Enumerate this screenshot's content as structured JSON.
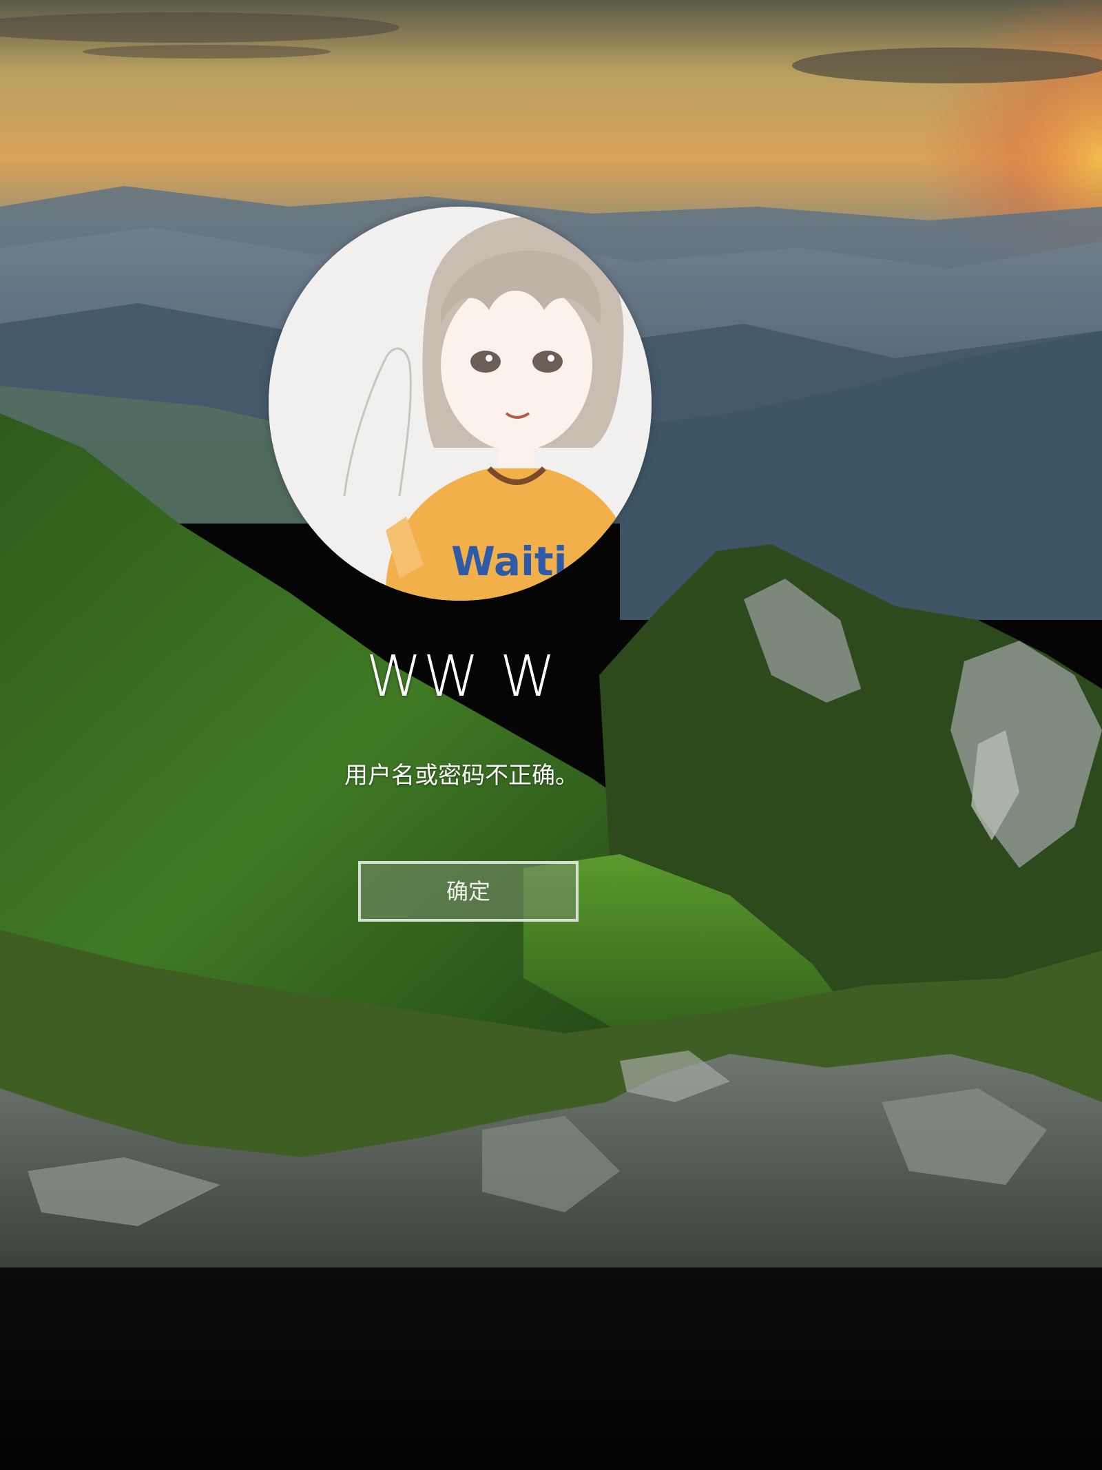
{
  "login": {
    "user_name": "WW W",
    "error_message": "用户名或密码不正确。",
    "ok_button_label": "确定",
    "avatar": "user-avatar-anime-girl",
    "avatar_shirt_text": "Waiti"
  },
  "background": {
    "scene": "mountain-sunrise-wallpaper"
  },
  "colors": {
    "text": "#ffffff",
    "button_fill": "#788c6e",
    "button_border": "#ebf0e6"
  }
}
